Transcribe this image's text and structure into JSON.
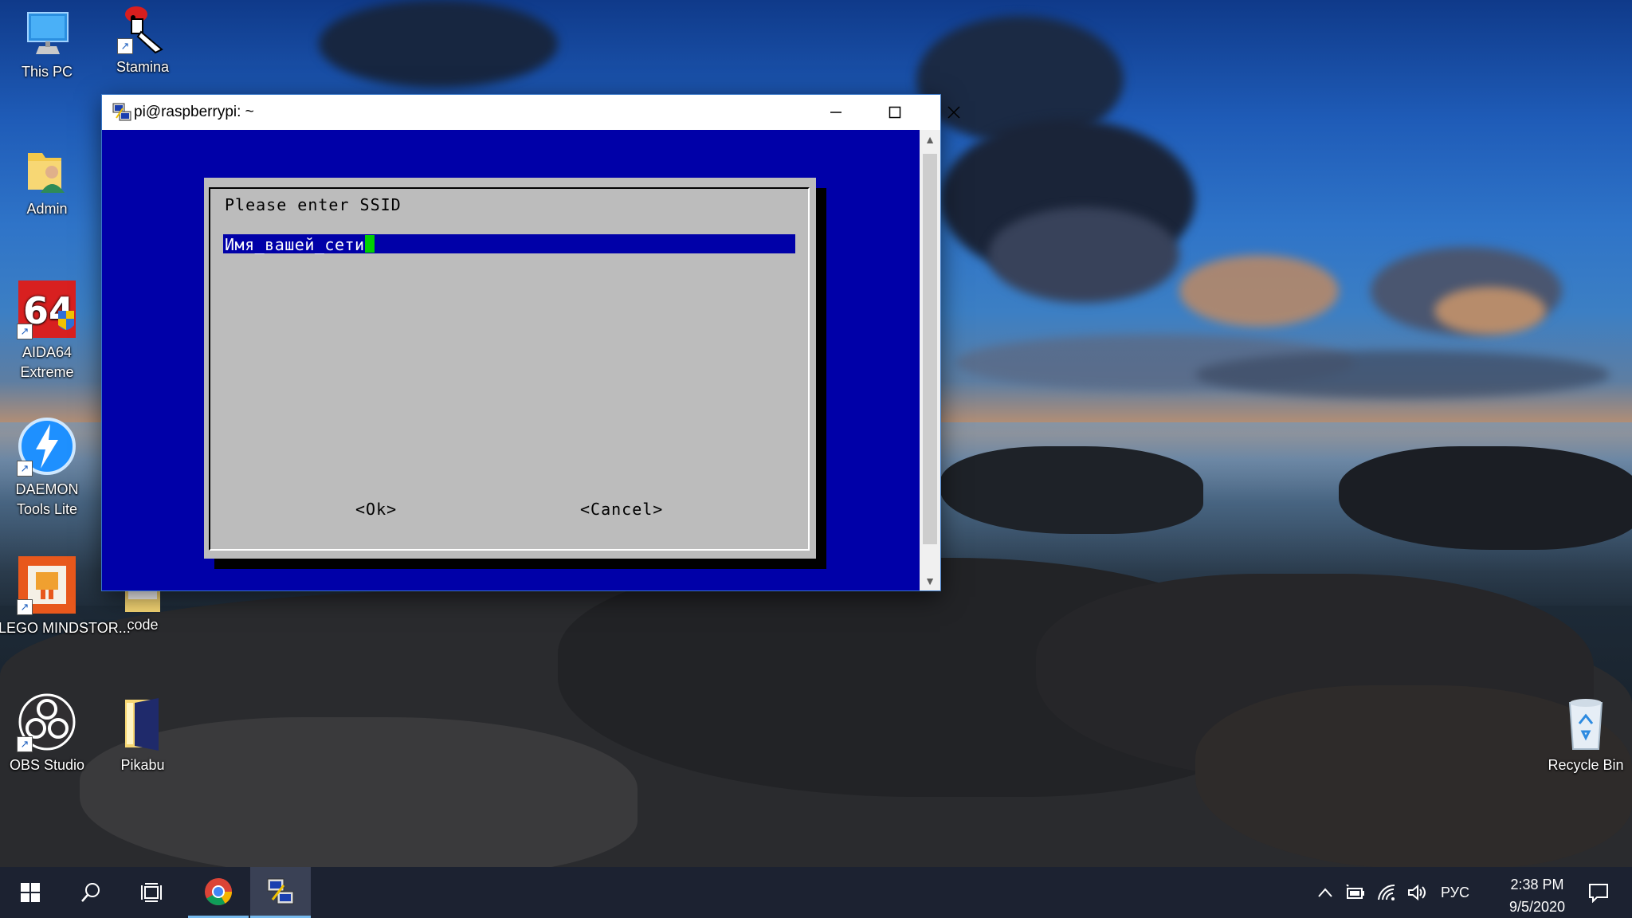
{
  "desktop": {
    "icons": [
      {
        "label": "This PC",
        "icon": "this-pc-icon"
      },
      {
        "label": "Stamina",
        "icon": "stamina-icon"
      },
      {
        "label": "Admin",
        "icon": "user-folder-icon"
      },
      {
        "label": "AIDA64 Extreme",
        "icon": "aida64-icon"
      },
      {
        "label": "DAEMON Tools Lite",
        "icon": "daemon-tools-icon"
      },
      {
        "label": "LEGO MINDSTOR...",
        "icon": "lego-mindstorms-icon"
      },
      {
        "label": "code",
        "icon": "folder-icon"
      },
      {
        "label": "OBS Studio",
        "icon": "obs-icon"
      },
      {
        "label": "Pikabu",
        "icon": "folder-icon"
      },
      {
        "label": "Recycle Bin",
        "icon": "recycle-bin-icon"
      }
    ]
  },
  "window": {
    "title": "pi@raspberrypi: ~",
    "controls": [
      "minimize-icon",
      "maximize-icon",
      "close-icon"
    ]
  },
  "dialog": {
    "prompt": "Please enter SSID",
    "input_value": "Имя_вашей_сети",
    "ok_label": "<Ok>",
    "cancel_label": "<Cancel>"
  },
  "taskbar": {
    "language": "РУС",
    "time": "2:38 PM",
    "date": "9/5/2020"
  },
  "colors": {
    "terminal_bg": "#0000a8",
    "dialog_bg": "#bcbcbc",
    "cursor": "#00d000",
    "taskbar_bg": "#1c2231",
    "accent": "#76b9ed"
  }
}
